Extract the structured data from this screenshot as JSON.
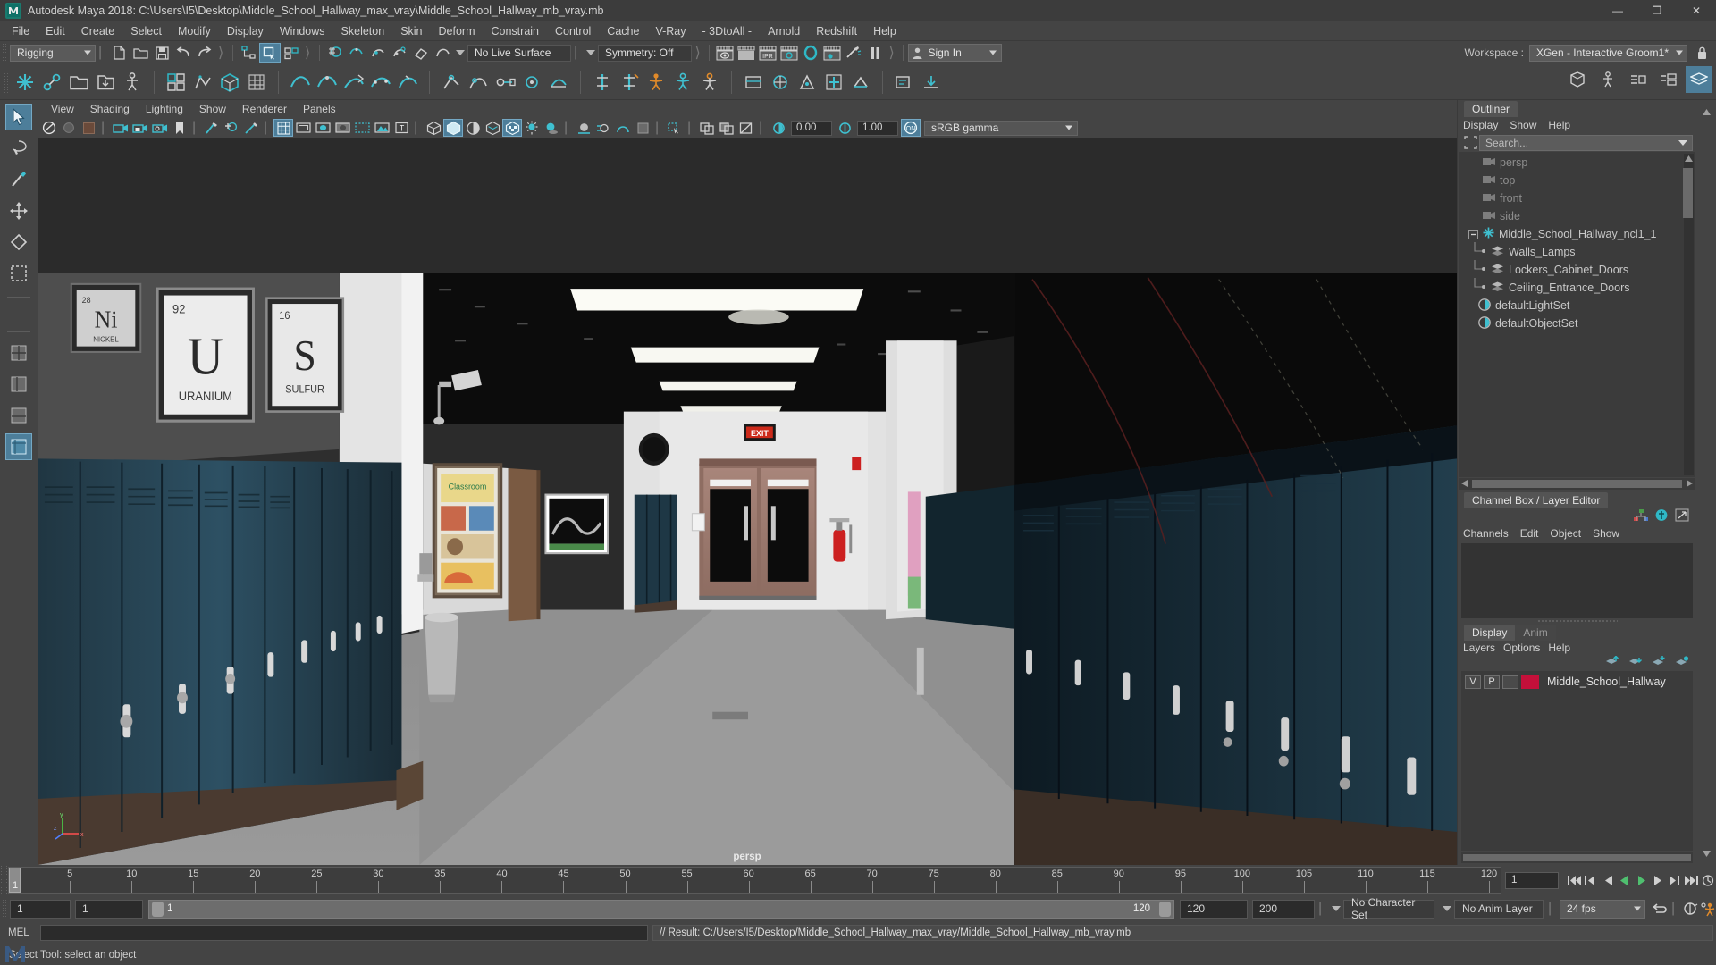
{
  "title_bar": {
    "app_title": "Autodesk Maya 2018: C:\\Users\\I5\\Desktop\\Middle_School_Hallway_max_vray\\Middle_School_Hallway_mb_vray.mb",
    "logo_text": "M",
    "minimize": "—",
    "maximize": "❐",
    "close": "✕"
  },
  "menu_bar": {
    "items": [
      {
        "label": "File"
      },
      {
        "label": "Edit"
      },
      {
        "label": "Create"
      },
      {
        "label": "Select"
      },
      {
        "label": "Modify"
      },
      {
        "label": "Display"
      },
      {
        "label": "Windows"
      },
      {
        "label": "Skeleton"
      },
      {
        "label": "Skin"
      },
      {
        "label": "Deform"
      },
      {
        "label": "Constrain"
      },
      {
        "label": "Control"
      },
      {
        "label": "Cache"
      },
      {
        "label": "V-Ray"
      },
      {
        "label": "- 3DtoAll -"
      },
      {
        "label": "Arnold"
      },
      {
        "label": "Redshift"
      },
      {
        "label": "Help"
      }
    ]
  },
  "status_line": {
    "menu_set": "Rigging",
    "live_surface": "No Live Surface",
    "symmetry": "Symmetry: Off",
    "sign_in": "Sign In",
    "workspace_label": "Workspace :",
    "workspace_value": "XGen - Interactive Groom1*"
  },
  "viewport_menu": {
    "items": [
      {
        "label": "View"
      },
      {
        "label": "Shading"
      },
      {
        "label": "Lighting"
      },
      {
        "label": "Show"
      },
      {
        "label": "Renderer"
      },
      {
        "label": "Panels"
      }
    ]
  },
  "viewport_toolbar": {
    "exposure_value": "0.00",
    "gamma_value": "1.00",
    "color_management": "sRGB gamma"
  },
  "viewport": {
    "camera_caption": "persp",
    "axis_x": "x",
    "axis_y": "y",
    "axis_z": "z",
    "exit_sign": "EXIT",
    "poster_u_number": "92",
    "poster_u_symbol": "U",
    "poster_u_name": "URANIUM",
    "poster_s_number": "16",
    "poster_s_symbol": "S",
    "poster_s_name": "SULFUR",
    "poster_ni_number": "28",
    "poster_ni_symbol": "Ni",
    "poster_ni_name": "NICKEL"
  },
  "outliner": {
    "tab_label": "Outliner",
    "menus": [
      {
        "label": "Display"
      },
      {
        "label": "Show"
      },
      {
        "label": "Help"
      }
    ],
    "search_placeholder": "Search...",
    "items": [
      {
        "label": "persp",
        "icon": "camera-icon",
        "dim": true,
        "indent": 22,
        "expander": false
      },
      {
        "label": "top",
        "icon": "camera-icon",
        "dim": true,
        "indent": 22,
        "expander": false
      },
      {
        "label": "front",
        "icon": "camera-icon",
        "dim": true,
        "indent": 22,
        "expander": false
      },
      {
        "label": "side",
        "icon": "camera-icon",
        "dim": true,
        "indent": 22,
        "expander": false
      },
      {
        "label": "Middle_School_Hallway_ncl1_1",
        "icon": "asterisk-icon",
        "dim": false,
        "indent": 18,
        "expander": true
      },
      {
        "label": "Walls_Lamps",
        "icon": "mesh-icon",
        "dim": false,
        "indent": 34,
        "expander": false,
        "branch": true
      },
      {
        "label": "Lockers_Cabinet_Doors",
        "icon": "mesh-icon",
        "dim": false,
        "indent": 34,
        "expander": false,
        "branch": true
      },
      {
        "label": "Ceiling_Entrance_Doors",
        "icon": "mesh-icon",
        "dim": false,
        "indent": 34,
        "expander": false,
        "branch": true
      },
      {
        "label": "defaultLightSet",
        "icon": "set-icon",
        "dim": false,
        "indent": 20,
        "expander": false
      },
      {
        "label": "defaultObjectSet",
        "icon": "set-icon",
        "dim": false,
        "indent": 20,
        "expander": false
      }
    ]
  },
  "channel_box": {
    "tab_label": "Channel Box / Layer Editor",
    "menus": [
      {
        "label": "Channels"
      },
      {
        "label": "Edit"
      },
      {
        "label": "Object"
      },
      {
        "label": "Show"
      }
    ]
  },
  "layer_editor": {
    "tabs": [
      {
        "label": "Display",
        "active": true
      },
      {
        "label": "Anim",
        "active": false
      }
    ],
    "menus": [
      {
        "label": "Layers"
      },
      {
        "label": "Options"
      },
      {
        "label": "Help"
      }
    ],
    "rows": [
      {
        "visibility": "V",
        "playback": "P",
        "state": "",
        "color": "#c4103a",
        "name": "Middle_School_Hallway"
      }
    ]
  },
  "time_slider": {
    "current_frame": "1",
    "ticks": [
      5,
      10,
      15,
      20,
      25,
      30,
      35,
      40,
      45,
      50,
      55,
      60,
      65,
      70,
      75,
      80,
      85,
      90,
      95,
      100,
      105,
      110,
      115,
      120
    ],
    "start": 1,
    "end": 120,
    "frame_field": "1"
  },
  "range_slider": {
    "anim_start": "1",
    "range_start": "1",
    "bar_start": "1",
    "bar_end": "120",
    "range_end": "120",
    "anim_end": "200",
    "character_set": "No Character Set",
    "anim_layer": "No Anim Layer",
    "fps": "24 fps"
  },
  "command_line": {
    "language_label": "MEL",
    "input_value": "",
    "result_text": "// Result: C:/Users/I5/Desktop/Middle_School_Hallway_max_vray/Middle_School_Hallway_mb_vray.mb"
  },
  "status_bar": {
    "help_text": "Select Tool: select an object"
  },
  "colors": {
    "accent_teal": "#2fb8c6",
    "selection_blue": "#4d7e9a",
    "panel_bg": "#444444",
    "field_bg": "#2b2b2b",
    "layer_red": "#c4103a"
  }
}
